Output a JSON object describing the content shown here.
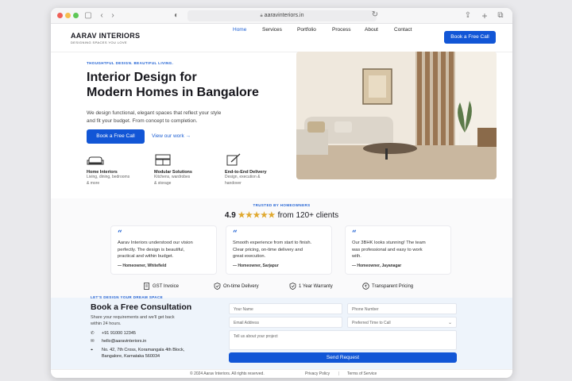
{
  "browser": {
    "url": "aaravinteriors.in"
  },
  "nav": {
    "brand_name": "AARAV INTERIORS",
    "brand_tagline": "DESIGNING SPACES YOU LOVE",
    "links": [
      "Home",
      "Services",
      "Portfolio",
      "Process",
      "About",
      "Contact"
    ],
    "active": "Home",
    "cta": "Book a Free Call"
  },
  "hero": {
    "eyebrow": "THOUGHTFUL DESIGN. BEAUTIFUL LIVING.",
    "title_line1": "Interior Design for",
    "title_line2": "Modern Homes in Bangalore",
    "sub_line1": "We design functional, elegant spaces that reflect your style",
    "sub_line2": "and fit your budget. From concept to completion.",
    "cta_primary": "Book a Free Call",
    "cta_secondary": "View our work →"
  },
  "features": [
    {
      "icon": "sofa-icon",
      "title": "Home Interiors",
      "line1": "Living, dining, bedrooms",
      "line2": "& more"
    },
    {
      "icon": "kitchen-icon",
      "title": "Modular Solutions",
      "line1": "Kitchens, wardrobes",
      "line2": "& storage"
    },
    {
      "icon": "document-pen-icon",
      "title": "End-to-End Delivery",
      "line1": "Design, execution &",
      "line2": "handover"
    }
  ],
  "proof": {
    "eyebrow": "TRUSTED BY HOMEOWNERS",
    "rating": "4.9",
    "stars": 5,
    "clients": "from 120+ clients",
    "testimonials": [
      {
        "line1": "Aarav Interiors understood our vision",
        "line2": "perfectly. The design is beautiful,",
        "line3": "practical and within budget.",
        "author": "— Homeowner, Whitefield"
      },
      {
        "line1": "Smooth experience from start to finish.",
        "line2": "Clear pricing, on-time delivery and",
        "line3": "great execution.",
        "author": "— Homeowner, Sarjapur"
      },
      {
        "line1": "Our 3BHK looks stunning! The team",
        "line2": "was professional and easy to work",
        "line3": "with.",
        "author": "— Homeowner, Jayanagar"
      }
    ],
    "badges": [
      "GST Invoice",
      "On-time Delivery",
      "1 Year Warranty",
      "Transparent Pricing"
    ]
  },
  "contact": {
    "eyebrow": "LET'S DESIGN YOUR DREAM SPACE",
    "title": "Book a Free Consultation",
    "sub_line1": "Share your requirements and we'll get back",
    "sub_line2": "within 24 hours.",
    "phone": "+91 91000 12345",
    "email": "hello@aaravinteriors.in",
    "address_line1": "No. 42, 7th Cross, Koramangala 4th Block,",
    "address_line2": "Bangalore, Karnataka 560034",
    "form": {
      "name_placeholder": "Your Name",
      "phone_placeholder": "Phone Number",
      "email_placeholder": "Email Address",
      "time_placeholder": "Preferred Time to Call",
      "project_placeholder": "Tell us about your project",
      "submit": "Send Request"
    }
  },
  "footer": {
    "copyright": "© 2024 Aarav Interiors. All rights reserved.",
    "privacy": "Privacy Policy",
    "terms": "Terms of Service"
  },
  "colors": {
    "accent": "#1256d6",
    "star": "#e0a82e",
    "contact_bg": "#eef4fb"
  }
}
